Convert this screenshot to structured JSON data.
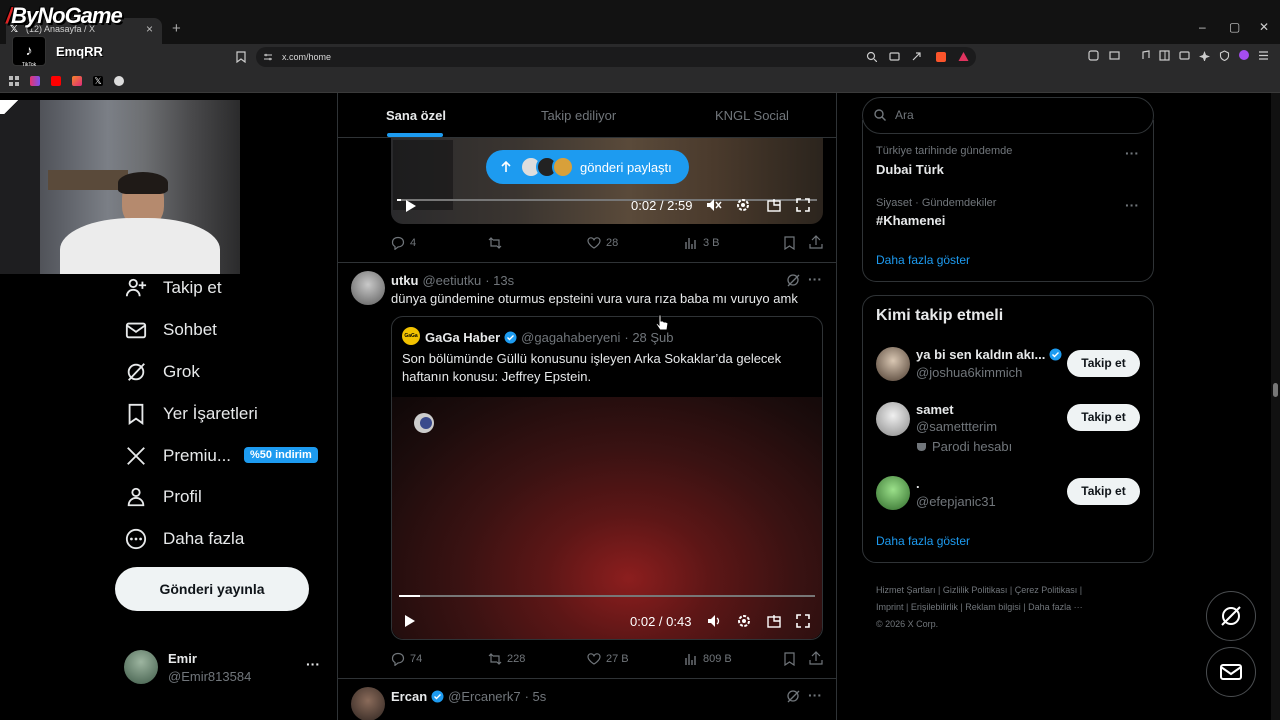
{
  "overlay": {
    "logo_text": "ByNoGame",
    "tiktok_label": "TikTok",
    "tiktok_user": "EmqRR"
  },
  "browser": {
    "tab_title": "(12) Anasayfa / X",
    "url": "x.com/home",
    "new_tab": "+",
    "close": "×",
    "win_min": "–",
    "win_max": "▢",
    "win_close": "✕"
  },
  "sidebar": {
    "items": [
      {
        "label": "Takip et",
        "icon": "person-add-icon"
      },
      {
        "label": "Sohbet",
        "icon": "mail-icon"
      },
      {
        "label": "Grok",
        "icon": "grok-icon"
      },
      {
        "label": "Yer İşaretleri",
        "icon": "bookmark-icon"
      },
      {
        "label": "Premiu...",
        "icon": "x-logo-icon"
      },
      {
        "label": "Profil",
        "icon": "profile-icon"
      },
      {
        "label": "Daha fazla",
        "icon": "more-circle-icon"
      }
    ],
    "premium_badge": "%50 indirim",
    "post_button": "Gönderi yayınla",
    "profile": {
      "name": "Emir",
      "handle": "@Emir813584",
      "more": "···"
    }
  },
  "feed": {
    "tabs": [
      "Sana özel",
      "Takip ediliyor",
      "KNGL Social"
    ],
    "toast": "gönderi paylaştı",
    "post1": {
      "time": "0:02 / 2:59",
      "progress": 0.01,
      "replies": "4",
      "reposts": "",
      "likes": "28",
      "views": "3 B"
    },
    "post2": {
      "author": "utku",
      "handle": "@eetiutku",
      "time": "· 13s",
      "text": "dünya gündemine oturmus epsteini vura vura rıza baba mı vuruyo amk",
      "quote": {
        "author": "GaGa Haber",
        "handle": "@gagahaberyeni",
        "date": "· 28 Şub",
        "avatar_text": "GaGa",
        "text": "Son bölümünde Güllü konusunu işleyen Arka Sokaklar’da gelecek haftanın konusu: Jeffrey Epstein.",
        "video_time": "0:02 / 0:43",
        "progress": 0.05
      },
      "replies": "74",
      "reposts": "228",
      "likes": "27 B",
      "views": "809 B"
    },
    "post3": {
      "author": "Ercan",
      "handle": "@Ercanerk7",
      "time": "· 5s"
    }
  },
  "right": {
    "search_placeholder": "Ara",
    "trends": [
      {
        "category": "Türkiye tarihinde gündemde",
        "title": "Dubai Türk"
      },
      {
        "category": "Siyaset · Gündemdekiler",
        "title": "#Khamenei"
      }
    ],
    "show_more": "Daha fazla göster",
    "who_to_follow": {
      "title": "Kimi takip etmeli",
      "users": [
        {
          "name": "ya bi sen kaldın akı...",
          "handle": "@joshua6kimmich",
          "verified": true,
          "note": ""
        },
        {
          "name": "samet",
          "handle": "@samettterim",
          "verified": false,
          "note": "Parodi hesabı"
        },
        {
          "name": ".",
          "handle": "@efepjanic31",
          "verified": false,
          "note": ""
        }
      ],
      "follow_label": "Takip et",
      "show_more": "Daha fazla göster"
    },
    "footer": [
      "Hizmet Şartları",
      "Gizlilik Politikası",
      "Çerez Politikası",
      "Imprint",
      "Erişilebilirlik",
      "Reklam bilgisi",
      "Daha fazla ···",
      "© 2026 X Corp."
    ]
  },
  "colors": {
    "accent": "#1d9bf0",
    "bg": "#000000",
    "border": "#2f3336",
    "muted": "#71767b",
    "text": "#e7e9ea"
  }
}
